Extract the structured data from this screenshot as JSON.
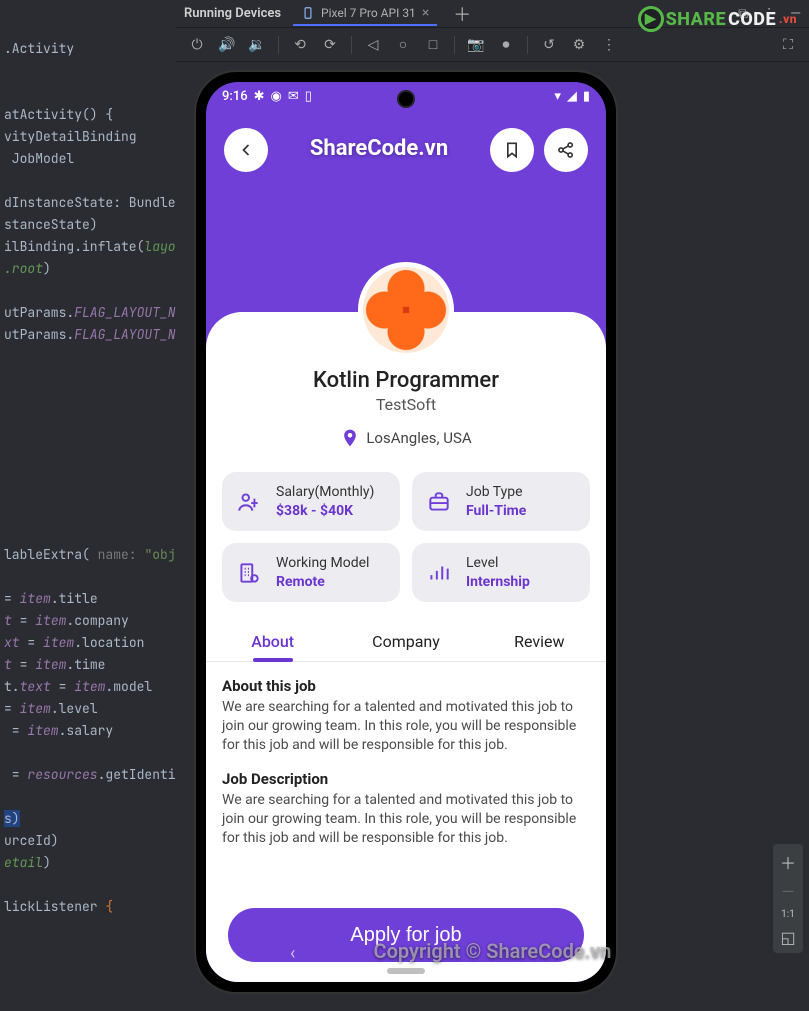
{
  "code": {
    "lines": [
      {
        "t": ".Activity",
        "cls": ""
      },
      {
        "t": "",
        "cls": ""
      },
      {
        "t": "",
        "cls": ""
      },
      {
        "t": "atActivity() {",
        "cls": ""
      },
      {
        "t": "vityDetailBinding",
        "cls": ""
      },
      {
        "t": " JobModel",
        "cls": ""
      },
      {
        "t": "",
        "cls": ""
      },
      {
        "t": "dInstanceState: Bundle",
        "cls": ""
      },
      {
        "t": "stanceState)",
        "cls": ""
      },
      {
        "t": "ilBinding.inflate(layo",
        "cls": "param-line"
      },
      {
        "t": ".root)",
        "cls": "param-line2"
      },
      {
        "t": "",
        "cls": ""
      },
      {
        "t": "utParams.FLAG_LAYOUT_N",
        "cls": "const-line"
      },
      {
        "t": "utParams.FLAG_LAYOUT_N",
        "cls": "const-line"
      }
    ]
  },
  "watermark": {
    "logo_share": "SHARE",
    "logo_code": "CODE",
    "logo_vn": ".vn",
    "footer": "Copyright © ShareCode.vn"
  },
  "panel": {
    "title": "Running Devices",
    "tab": "Pixel 7 Pro API 31"
  },
  "zoom": {
    "label": "1:1"
  },
  "phone": {
    "status": {
      "time": "9:16"
    },
    "header": {
      "title": "ShareCode.vn"
    },
    "job": {
      "title": "Kotlin Programmer",
      "company": "TestSoft",
      "location": "LosAngles, USA"
    },
    "info": {
      "salary_label": "Salary(Monthly)",
      "salary_value": "$38k - $40K",
      "jobtype_label": "Job Type",
      "jobtype_value": "Full-Time",
      "model_label": "Working Model",
      "model_value": "Remote",
      "level_label": "Level",
      "level_value": "Internship"
    },
    "tabs": {
      "about": "About",
      "company": "Company",
      "review": "Review"
    },
    "about": {
      "h1": "About this job",
      "p1": "We are searching for a talented and motivated this job to join our growing team. In this role, you will be responsible for this job and will be responsible for this job.",
      "h2": "Job Description",
      "p2": "We are searching for a talented and motivated this job to join our growing team. In this role, you will be responsible for this job and will be responsible for this job."
    },
    "apply": "Apply for job"
  }
}
